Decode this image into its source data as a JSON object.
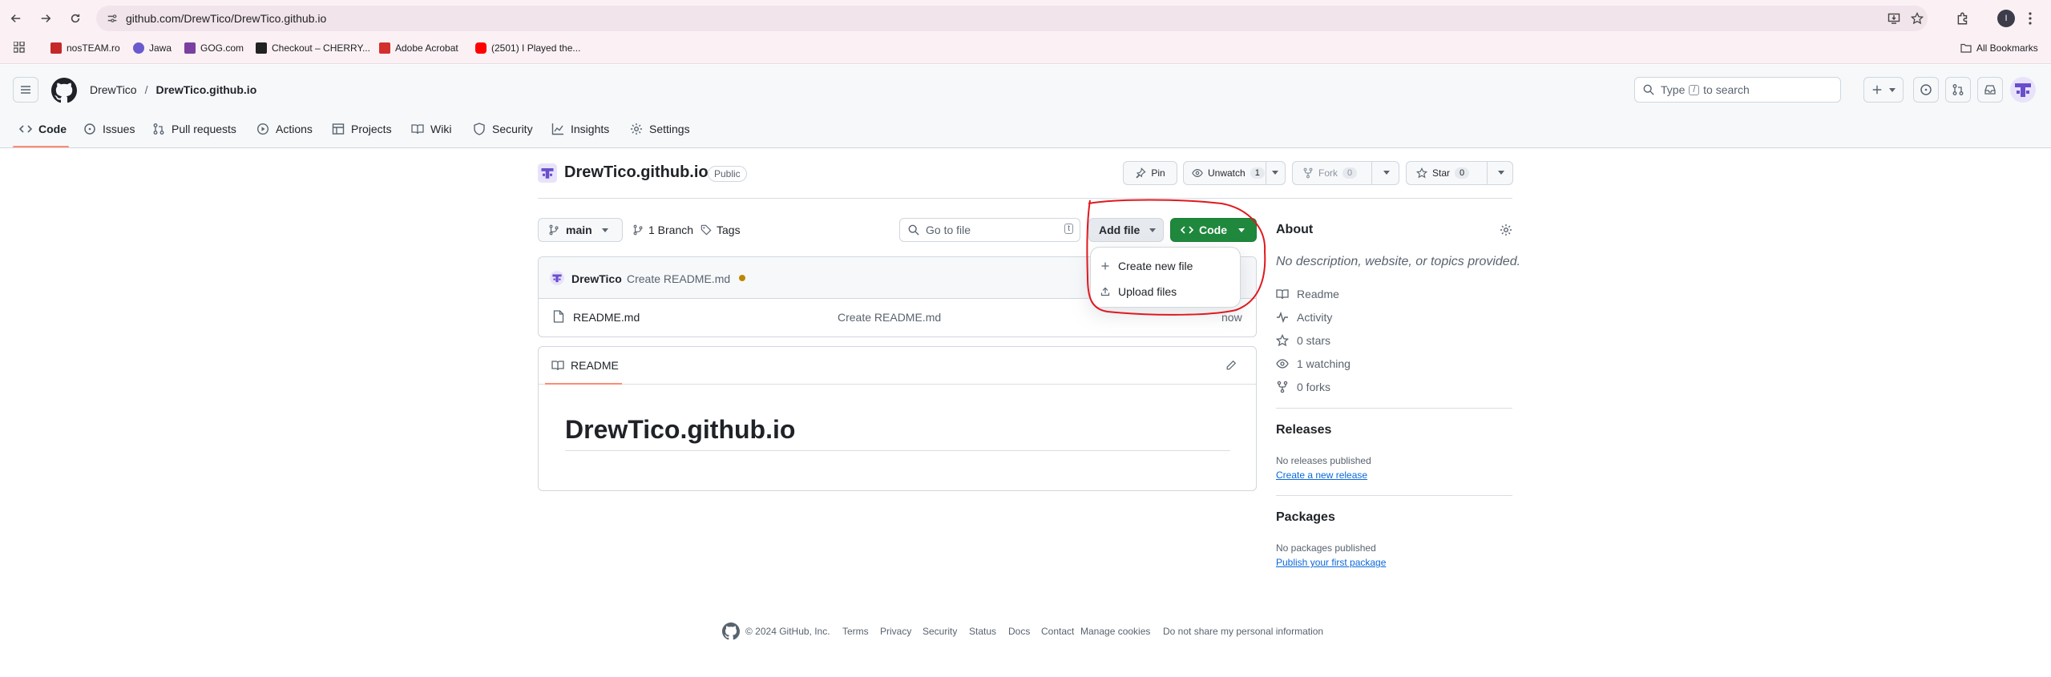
{
  "browser": {
    "url": "github.com/DrewTico/DrewTico.github.io",
    "bookmarks": [
      {
        "label": "nosTEAM.ro",
        "color": "#c62828"
      },
      {
        "label": "Jawa",
        "color": "#6a5acd"
      },
      {
        "label": "GOG.com",
        "color": "#7b3fa0"
      },
      {
        "label": "Checkout – CHERRY...",
        "color": "#222222"
      },
      {
        "label": "Adobe Acrobat",
        "color": "#d32f2f"
      },
      {
        "label": "(2501) I Played the...",
        "color": "#ff0000"
      }
    ],
    "all_bookmarks": "All Bookmarks",
    "profile_initial": "I"
  },
  "header": {
    "owner": "DrewTico",
    "separator": "/",
    "repo": "DrewTico.github.io",
    "search_placeholder": "Type / to search",
    "search_prefix": "Type",
    "search_key": "/",
    "search_suffix": "to search"
  },
  "tabs": [
    {
      "label": "Code"
    },
    {
      "label": "Issues"
    },
    {
      "label": "Pull requests"
    },
    {
      "label": "Actions"
    },
    {
      "label": "Projects"
    },
    {
      "label": "Wiki"
    },
    {
      "label": "Security"
    },
    {
      "label": "Insights"
    },
    {
      "label": "Settings"
    }
  ],
  "repo": {
    "title": "DrewTico.github.io",
    "visibility": "Public",
    "pin": "Pin",
    "unwatch": "Unwatch",
    "watch_count": "1",
    "fork": "Fork",
    "fork_count": "0",
    "star": "Star",
    "star_count": "0"
  },
  "toolbar": {
    "branch": "main",
    "branches": "1 Branch",
    "tags": "Tags",
    "goto_placeholder": "Go to file",
    "goto_key": "t",
    "add_file": "Add file",
    "code": "Code"
  },
  "dropdown": {
    "items": [
      "Create new file",
      "Upload files"
    ]
  },
  "commit": {
    "author": "DrewTico",
    "message": "Create README.md"
  },
  "files": [
    {
      "name": "README.md",
      "message": "Create README.md",
      "time": "now"
    }
  ],
  "readme": {
    "tab": "README",
    "heading": "DrewTico.github.io"
  },
  "about": {
    "title": "About",
    "description": "No description, website, or topics provided.",
    "items": [
      "Readme",
      "Activity",
      "0 stars",
      "1 watching",
      "0 forks"
    ]
  },
  "releases": {
    "title": "Releases",
    "none": "No releases published",
    "link": "Create a new release"
  },
  "packages": {
    "title": "Packages",
    "none": "No packages published",
    "link": "Publish your first package"
  },
  "footer": {
    "copyright": "© 2024 GitHub, Inc.",
    "links": [
      "Terms",
      "Privacy",
      "Security",
      "Status",
      "Docs",
      "Contact",
      "Manage cookies",
      "Do not share my personal information"
    ]
  },
  "colors": {
    "accent_green": "#1f883d",
    "tab_underline": "#fd8c73",
    "annotation_red": "#e0191f",
    "avatar_purple": "#6a4ecb"
  }
}
